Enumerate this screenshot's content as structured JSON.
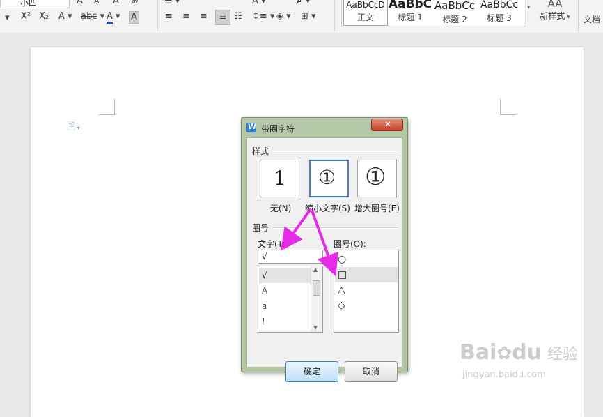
{
  "ribbon": {
    "font_size_value": "小四",
    "buttons": {
      "superscript": "X²",
      "subscript": "X₂",
      "text_effect": "A",
      "phonetic": "abc",
      "font_color": "A",
      "char_shading": "A",
      "grow_font": "A",
      "shrink_font": "A"
    },
    "styles": [
      {
        "preview": "AaBbCcD",
        "name": "正文"
      },
      {
        "preview": "AaBbC",
        "name": "标题 1"
      },
      {
        "preview": "AaBbCc",
        "name": "标题 2"
      },
      {
        "preview": "AaBbCc",
        "name": "标题 3"
      }
    ],
    "new_style_label": "新样式",
    "new_style_icon_text": "AA",
    "doc_tools_label": "文档",
    "colors": {
      "font_color_bar": "#1f3fd1",
      "accent": "#2f7fd8"
    }
  },
  "dialog": {
    "title": "带圈字符",
    "style_group": "样式",
    "style_options": [
      {
        "label": "无(N)",
        "preview": "1"
      },
      {
        "label": "缩小文字(S)",
        "preview": "①"
      },
      {
        "label": "增大圈号(E)",
        "preview": "①"
      }
    ],
    "circle_group": "圈号",
    "text_label": "文字(T):",
    "text_value": "√",
    "text_list": [
      "√",
      "A",
      "a",
      "!"
    ],
    "enclosure_label": "圈号(O):",
    "enclosure_list": [
      "○",
      "□",
      "△",
      "◇"
    ],
    "ok": "确定",
    "cancel": "取消"
  },
  "watermark": {
    "main": "Bai",
    "paw": "du",
    "sub_cn": "经验",
    "url": "jingyan.baidu.com"
  }
}
